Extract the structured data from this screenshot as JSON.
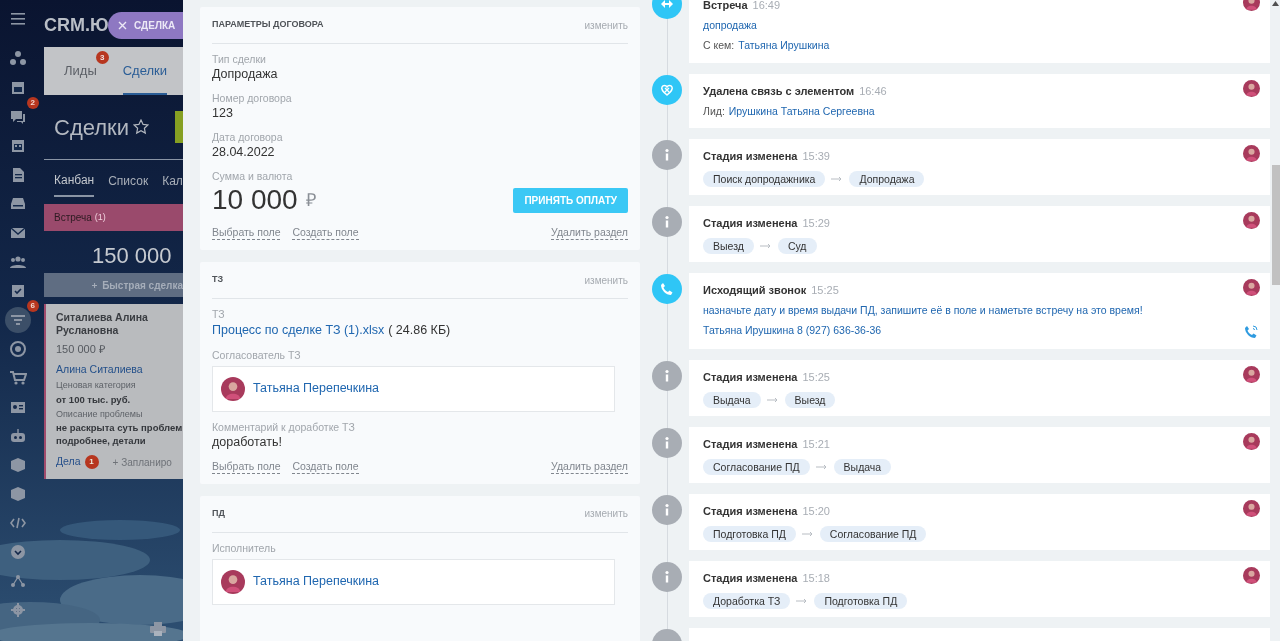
{
  "crm": {
    "logo": "CRM.Ю",
    "slider_tab": "СДЕЛКА",
    "left_bar": [
      {
        "kind": "flow",
        "selected": false
      },
      {
        "kind": "window",
        "selected": false
      },
      {
        "kind": "chat",
        "badge": "2",
        "selected": false
      },
      {
        "kind": "calendar",
        "selected": false
      },
      {
        "kind": "doc",
        "selected": false
      },
      {
        "kind": "drive",
        "selected": false
      },
      {
        "kind": "mail",
        "selected": false
      },
      {
        "kind": "people",
        "selected": false
      },
      {
        "kind": "task",
        "selected": false
      },
      {
        "kind": "funnel",
        "badge": "6",
        "selected": true
      },
      {
        "kind": "target",
        "selected": false
      },
      {
        "kind": "cart",
        "selected": false
      },
      {
        "kind": "contact",
        "selected": false
      },
      {
        "kind": "robot",
        "selected": false
      },
      {
        "kind": "box",
        "selected": false
      },
      {
        "kind": "box",
        "selected": false
      },
      {
        "kind": "code",
        "selected": false
      },
      {
        "kind": "more",
        "selected": false
      },
      {
        "kind": "sitemap",
        "selected": false
      },
      {
        "kind": "gear",
        "selected": false
      }
    ],
    "tabs": [
      {
        "label": "Лиды",
        "badge": "3",
        "selected": false
      },
      {
        "label": "Сделки",
        "selected": true
      }
    ],
    "page_title": "Сделки",
    "favorite": false,
    "view_tabs": [
      {
        "label": "Канбан",
        "selected": true
      },
      {
        "label": "Список",
        "selected": false
      },
      {
        "label": "Кал",
        "selected": false
      }
    ],
    "column": {
      "title": "Встреча",
      "count": "(1)",
      "total": "150 000",
      "quick_add": "Быстрая сделка"
    },
    "deal_card": {
      "title": "Ситалиева Алина Руслановна",
      "amount": "150 000 ₽",
      "contact": "Алина Ситалиева",
      "fields": [
        {
          "label": "Ценовая категория",
          "lines": [
            "от 100 тыс. руб."
          ]
        },
        {
          "label": "Описание проблемы",
          "lines": [
            "не раскрыта суть проблем",
            "подробнее, детали"
          ]
        }
      ],
      "activities": "Дела",
      "activities_badge": "1",
      "plan": "+ Запланиро"
    }
  },
  "sections": [
    {
      "title": "ПАРАМЕТРЫ ДОГОВОРА",
      "edit": "изменить",
      "fields": [
        {
          "kind": "text",
          "label": "Тип сделки",
          "value": "Допродажа"
        },
        {
          "kind": "text",
          "label": "Номер договора",
          "value": "123"
        },
        {
          "kind": "text",
          "label": "Дата договора",
          "value": "28.04.2022"
        },
        {
          "kind": "money",
          "label": "Сумма и валюта",
          "value": "10 000",
          "currency": "₽",
          "button": "ПРИНЯТЬ ОПЛАТУ"
        }
      ],
      "footer": {
        "select": "Выбрать поле",
        "create": "Создать поле",
        "delete": "Удалить раздел"
      }
    },
    {
      "title": "ТЗ",
      "edit": "изменить",
      "fields": [
        {
          "kind": "file",
          "label": "ТЗ",
          "value": "Процесс по сделке ТЗ (1).xlsx",
          "size": "( 24.86 КБ)"
        },
        {
          "kind": "user",
          "label": "Согласователь ТЗ",
          "value": "Татьяна Перепечкина"
        },
        {
          "kind": "text",
          "label": "Комментарий к доработке ТЗ",
          "value": "доработать!"
        }
      ],
      "footer": {
        "select": "Выбрать поле",
        "create": "Создать поле",
        "delete": "Удалить раздел"
      }
    },
    {
      "title": "ПД",
      "edit": "изменить",
      "fields": [
        {
          "kind": "user",
          "label": "Исполнитель",
          "value": "Татьяна Перепечкина"
        }
      ]
    }
  ],
  "timeline": [
    {
      "kind": "meeting",
      "title": "Встреча",
      "time": "16:49",
      "subject": "допродажа",
      "with_label": "С кем:",
      "with_name": "Татьяна Ирушкина"
    },
    {
      "kind": "unlink",
      "title": "Удалена связь с элементом",
      "time": "16:46",
      "ref_label": "Лид:",
      "ref_name": "Ирушкина Татьяна Сергеевна"
    },
    {
      "kind": "stage",
      "title": "Стадия изменена",
      "time": "15:39",
      "from": "Поиск допродажника",
      "to": "Допродажа"
    },
    {
      "kind": "stage",
      "title": "Стадия изменена",
      "time": "15:29",
      "from": "Выезд",
      "to": "Суд"
    },
    {
      "kind": "call",
      "title": "Исходящий звонок",
      "time": "15:25",
      "comment": "назначьте дату и время выдачи ПД, запишите её в поле и наметьте встречу на это время!",
      "contact": "Татьяна Ирушкина 8 (927) 636-36-36"
    },
    {
      "kind": "stage",
      "title": "Стадия изменена",
      "time": "15:25",
      "from": "Выдача",
      "to": "Выезд"
    },
    {
      "kind": "stage",
      "title": "Стадия изменена",
      "time": "15:21",
      "from": "Согласование ПД",
      "to": "Выдача"
    },
    {
      "kind": "stage",
      "title": "Стадия изменена",
      "time": "15:20",
      "from": "Подготовка ПД",
      "to": "Согласование ПД"
    },
    {
      "kind": "stage",
      "title": "Стадия изменена",
      "time": "15:18",
      "from": "Доработка ТЗ",
      "to": "Подготовка ПД"
    }
  ]
}
